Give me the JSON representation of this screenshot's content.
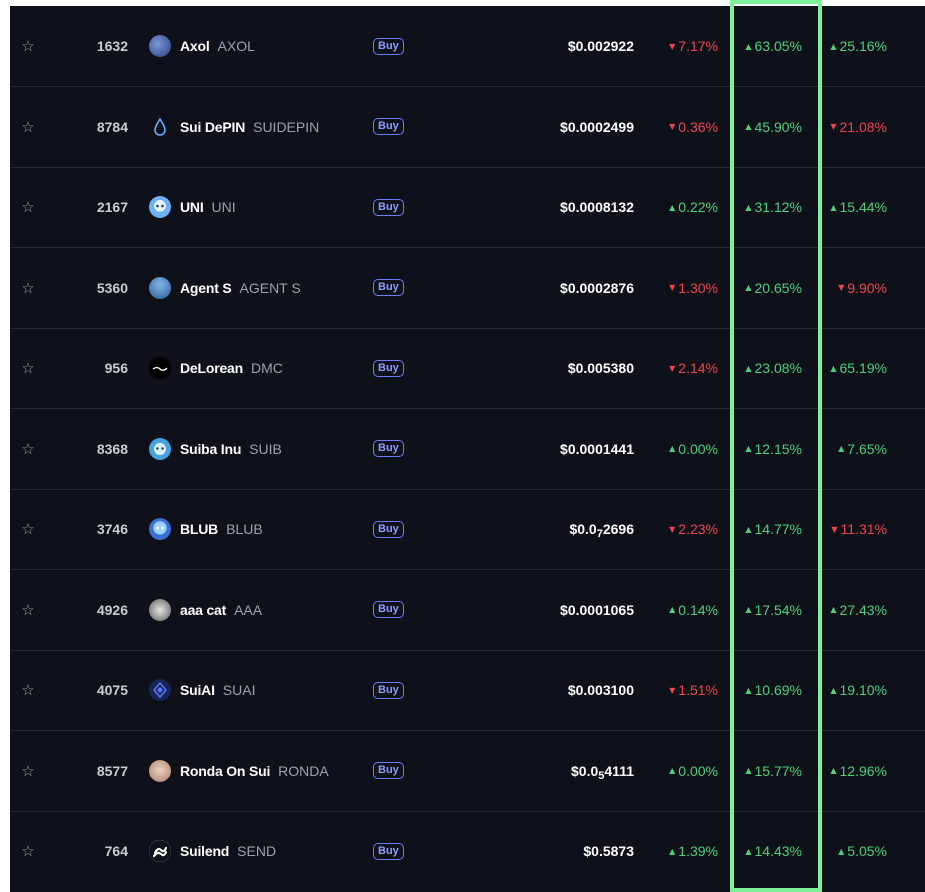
{
  "arrows": {
    "up": "▲",
    "down": "▼"
  },
  "star_glyph": "☆",
  "colors": {
    "up": "#4dcf7b",
    "down": "#f0454f",
    "highlight": "#7ff09a",
    "buy": "#8d9bff",
    "background": "#0e1119"
  },
  "rows": [
    {
      "rank": "1632",
      "name": "Axol",
      "symbol": "AXOL",
      "logo_icon": "axol-logo-icon",
      "buy": "Buy",
      "price_main": "$0.002922",
      "price_sub": "",
      "price_tail": "",
      "c1": {
        "dir": "down",
        "text": "7.17%"
      },
      "c2": {
        "dir": "up",
        "text": "63.05%"
      },
      "c3": {
        "dir": "up",
        "text": "25.16%"
      }
    },
    {
      "rank": "8784",
      "name": "Sui DePIN",
      "symbol": "SUIDEPIN",
      "logo_icon": "water-drop-icon",
      "buy": "Buy",
      "price_main": "$0.0002499",
      "price_sub": "",
      "price_tail": "",
      "c1": {
        "dir": "down",
        "text": "0.36%"
      },
      "c2": {
        "dir": "up",
        "text": "45.90%"
      },
      "c3": {
        "dir": "down",
        "text": "21.08%"
      }
    },
    {
      "rank": "2167",
      "name": "UNI",
      "symbol": "UNI",
      "logo_icon": "uni-logo-icon",
      "buy": "Buy",
      "price_main": "$0.0008132",
      "price_sub": "",
      "price_tail": "",
      "c1": {
        "dir": "up",
        "text": "0.22%"
      },
      "c2": {
        "dir": "up",
        "text": "31.12%"
      },
      "c3": {
        "dir": "up",
        "text": "15.44%"
      }
    },
    {
      "rank": "5360",
      "name": "Agent S",
      "symbol": "AGENT S",
      "logo_icon": "agent-s-logo-icon",
      "buy": "Buy",
      "price_main": "$0.0002876",
      "price_sub": "",
      "price_tail": "",
      "c1": {
        "dir": "down",
        "text": "1.30%"
      },
      "c2": {
        "dir": "up",
        "text": "20.65%"
      },
      "c3": {
        "dir": "down",
        "text": "9.90%"
      }
    },
    {
      "rank": "956",
      "name": "DeLorean",
      "symbol": "DMC",
      "logo_icon": "delorean-logo-icon",
      "buy": "Buy",
      "price_main": "$0.005380",
      "price_sub": "",
      "price_tail": "",
      "c1": {
        "dir": "down",
        "text": "2.14%"
      },
      "c2": {
        "dir": "up",
        "text": "23.08%"
      },
      "c3": {
        "dir": "up",
        "text": "65.19%"
      }
    },
    {
      "rank": "8368",
      "name": "Suiba Inu",
      "symbol": "SUIB",
      "logo_icon": "suiba-inu-logo-icon",
      "buy": "Buy",
      "price_main": "$0.0001441",
      "price_sub": "",
      "price_tail": "",
      "c1": {
        "dir": "up",
        "text": "0.00%"
      },
      "c2": {
        "dir": "up",
        "text": "12.15%"
      },
      "c3": {
        "dir": "up",
        "text": "7.65%"
      }
    },
    {
      "rank": "3746",
      "name": "BLUB",
      "symbol": "BLUB",
      "logo_icon": "blub-logo-icon",
      "buy": "Buy",
      "price_main": "$0.0",
      "price_sub": "7",
      "price_tail": "2696",
      "c1": {
        "dir": "down",
        "text": "2.23%"
      },
      "c2": {
        "dir": "up",
        "text": "14.77%"
      },
      "c3": {
        "dir": "down",
        "text": "11.31%"
      }
    },
    {
      "rank": "4926",
      "name": "aaa cat",
      "symbol": "AAA",
      "logo_icon": "aaa-cat-logo-icon",
      "buy": "Buy",
      "price_main": "$0.0001065",
      "price_sub": "",
      "price_tail": "",
      "c1": {
        "dir": "up",
        "text": "0.14%"
      },
      "c2": {
        "dir": "up",
        "text": "17.54%"
      },
      "c3": {
        "dir": "up",
        "text": "27.43%"
      }
    },
    {
      "rank": "4075",
      "name": "SuiAI",
      "symbol": "SUAI",
      "logo_icon": "suiai-logo-icon",
      "buy": "Buy",
      "price_main": "$0.003100",
      "price_sub": "",
      "price_tail": "",
      "c1": {
        "dir": "down",
        "text": "1.51%"
      },
      "c2": {
        "dir": "up",
        "text": "10.69%"
      },
      "c3": {
        "dir": "up",
        "text": "19.10%"
      }
    },
    {
      "rank": "8577",
      "name": "Ronda On Sui",
      "symbol": "RONDA",
      "logo_icon": "ronda-logo-icon",
      "buy": "Buy",
      "price_main": "$0.0",
      "price_sub": "5",
      "price_tail": "4111",
      "c1": {
        "dir": "up",
        "text": "0.00%"
      },
      "c2": {
        "dir": "up",
        "text": "15.77%"
      },
      "c3": {
        "dir": "up",
        "text": "12.96%"
      }
    },
    {
      "rank": "764",
      "name": "Suilend",
      "symbol": "SEND",
      "logo_icon": "suilend-logo-icon",
      "buy": "Buy",
      "price_main": "$0.5873",
      "price_sub": "",
      "price_tail": "",
      "c1": {
        "dir": "up",
        "text": "1.39%"
      },
      "c2": {
        "dir": "up",
        "text": "14.43%"
      },
      "c3": {
        "dir": "up",
        "text": "5.05%"
      }
    }
  ]
}
